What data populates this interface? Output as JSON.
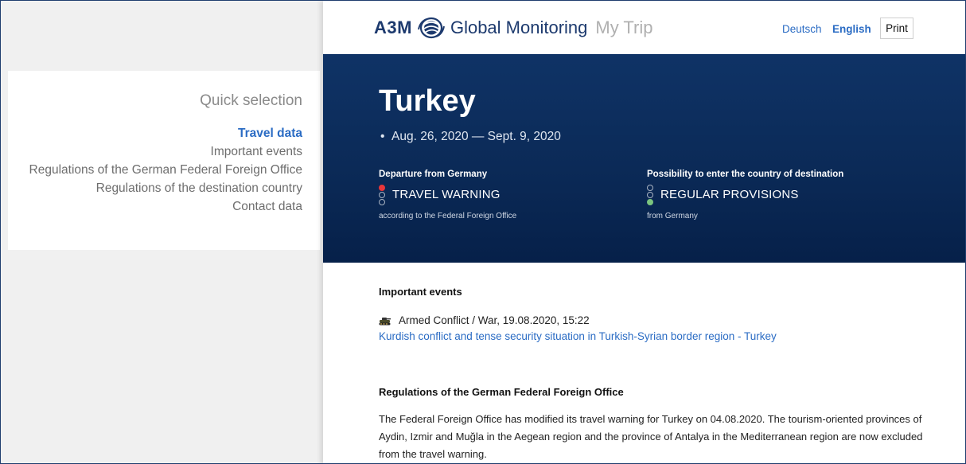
{
  "sidebar": {
    "title": "Quick selection",
    "items": [
      {
        "label": "Travel data"
      },
      {
        "label": "Important events"
      },
      {
        "label": "Regulations of the German Federal Foreign Office"
      },
      {
        "label": "Regulations of the destination country"
      },
      {
        "label": "Contact data"
      }
    ]
  },
  "header": {
    "brand_a3m": "A3M",
    "brand_name": "Global Monitoring",
    "brand_sub": "My Trip",
    "lang_de": "Deutsch",
    "lang_en": "English",
    "print": "Print"
  },
  "trip": {
    "country": "Turkey",
    "dates": "Aug. 26, 2020 — Sept. 9, 2020",
    "departure": {
      "title": "Departure from Germany",
      "status": "TRAVEL WARNING",
      "note": "according to the Federal Foreign Office",
      "light": "red"
    },
    "entry": {
      "title": "Possibility to enter the country of destination",
      "status": "REGULAR PROVISIONS",
      "note": "from Germany",
      "light": "green"
    }
  },
  "events": {
    "title": "Important events",
    "items": [
      {
        "icon": "tank-icon",
        "meta": "Armed Conflict / War, 19.08.2020, 15:22",
        "link": "Kurdish conflict and tense security situation in Turkish-Syrian border region - Turkey"
      }
    ]
  },
  "regulations": {
    "title": "Regulations of the German Federal Foreign Office",
    "text": "The Federal Foreign Office has modified its travel warning for Turkey on 04.08.2020. The tourism-oriented provinces of Aydin, Izmir and Muğla in the Aegean region and the province of Antalya in the Mediterranean region are now excluded from the travel warning."
  },
  "colors": {
    "accent": "#2b6cc4",
    "hero_bg": "#0b2a57",
    "brand": "#1d3a6e",
    "warning_red": "#e8363a",
    "ok_green": "#7bc47f"
  }
}
